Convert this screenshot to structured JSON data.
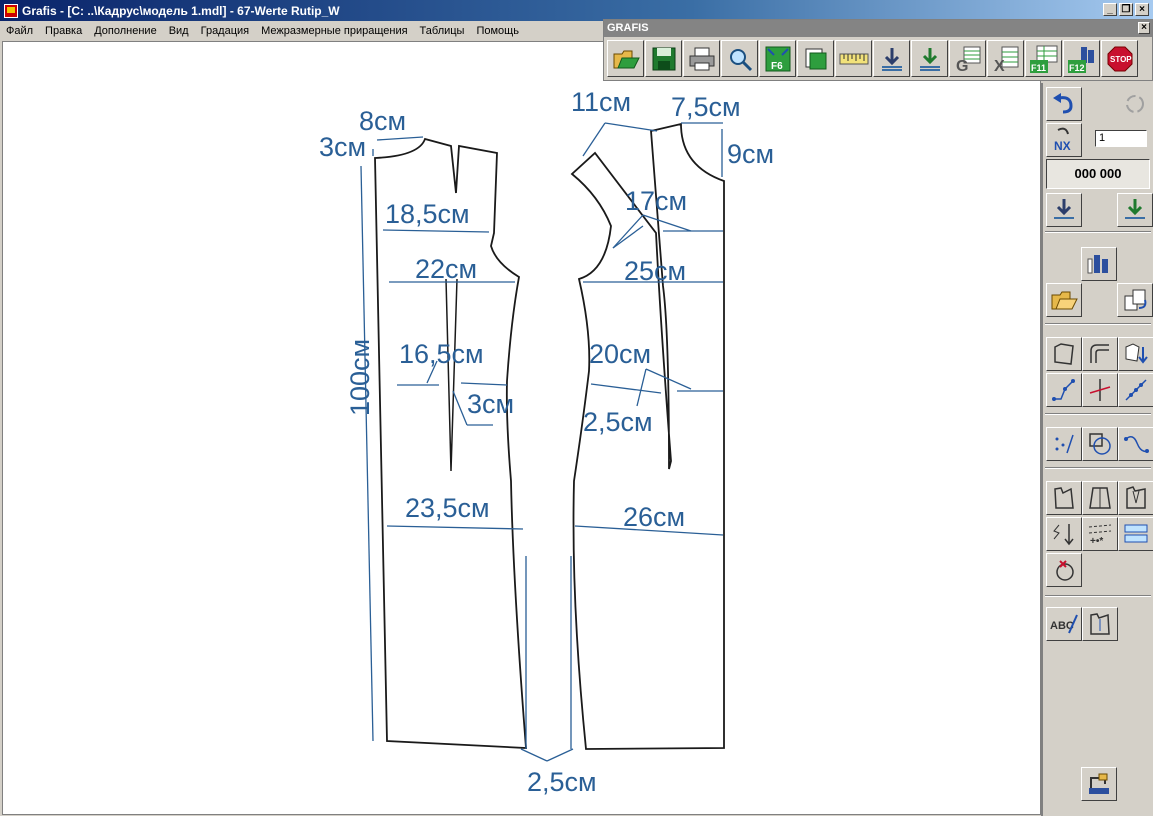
{
  "window": {
    "title": "Grafis - [C: ..\\Кадрус\\модель 1.mdl] - 67-Werte Rutip_W"
  },
  "menu": [
    "Файл",
    "Правка",
    "Дополнение",
    "Вид",
    "Градация",
    "Межразмерные приращения",
    "Таблицы",
    "Помощь"
  ],
  "panel": {
    "title": "GRAFIS",
    "close_label": "×",
    "tools": [
      {
        "icon": "open-folder-icon",
        "label": ""
      },
      {
        "icon": "save-disk-icon",
        "label": ""
      },
      {
        "icon": "print-icon",
        "label": ""
      },
      {
        "icon": "zoom-magnifier-icon",
        "label": ""
      },
      {
        "icon": "zoom-extents-f6-icon",
        "label": "F6"
      },
      {
        "icon": "layers-icon",
        "label": ""
      },
      {
        "icon": "measure-tape-icon",
        "label": ""
      },
      {
        "icon": "import-down-icon",
        "label": ""
      },
      {
        "icon": "import-grading-icon",
        "label": ""
      },
      {
        "icon": "graph-g-icon",
        "label": "G"
      },
      {
        "icon": "table-x-icon",
        "label": "X"
      },
      {
        "icon": "f11-table-icon",
        "label": "F11"
      },
      {
        "icon": "f12-figure-icon",
        "label": "F12"
      },
      {
        "icon": "stop-icon",
        "label": "STOP"
      }
    ]
  },
  "sidebar": {
    "nx_value": "1",
    "counter": "000 000"
  },
  "drawing": {
    "labels": {
      "neck_width": "8см",
      "shoulder_drop": "3см",
      "bust_back": "18,5см",
      "chest_back": "22см",
      "waist_back": "16,5см",
      "dart_back": "3см",
      "hip_back": "23,5см",
      "length": "100см",
      "front_shoulder": "11см",
      "front_neck_width": "7,5см",
      "front_neck_depth": "9см",
      "bust_front": "17см",
      "chest_front": "25см",
      "waist_front": "20см",
      "dart_front": "2,5см",
      "hip_front": "26см",
      "hem_ease": "2,5см"
    }
  }
}
